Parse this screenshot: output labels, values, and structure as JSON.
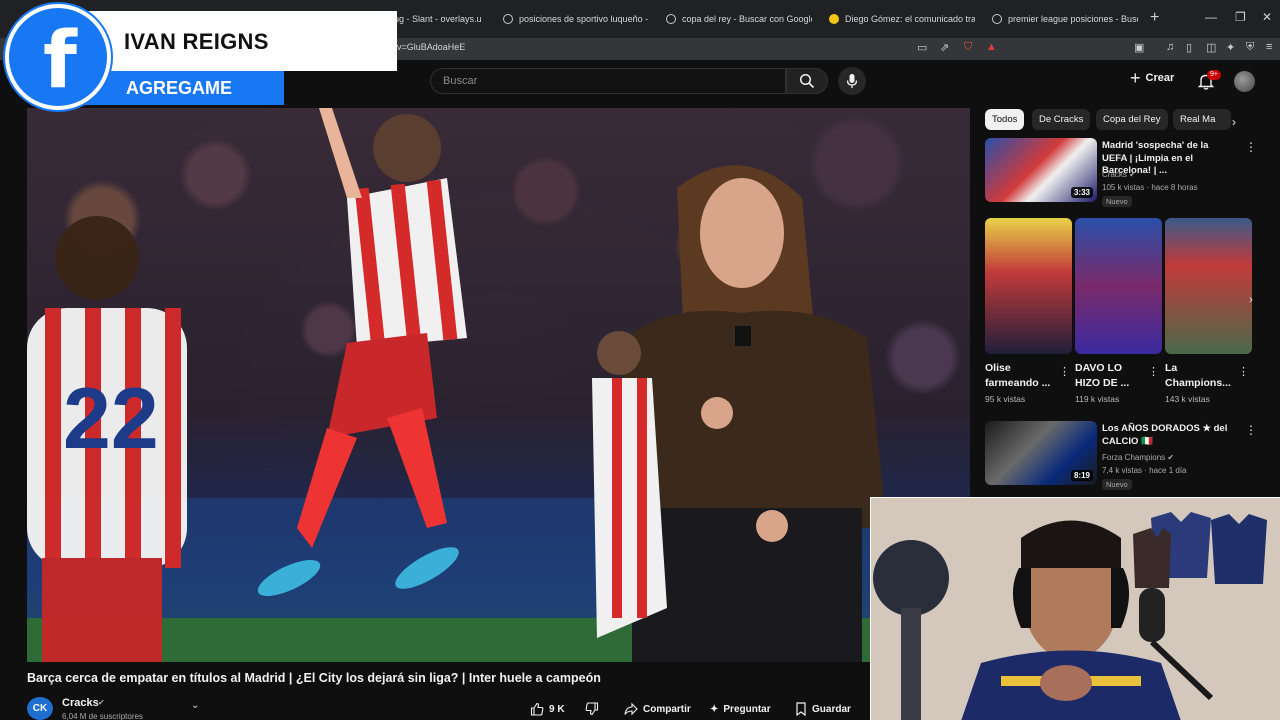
{
  "browser": {
    "tabs": [
      {
        "title": "ebug - Slant - overlays.u",
        "favicon": "debug"
      },
      {
        "title": "posiciones de sportivo luqueño - Bu",
        "favicon": "google"
      },
      {
        "title": "copa del rey - Buscar con Google",
        "favicon": "google"
      },
      {
        "title": "Diego Gómez: el comunicado tras la",
        "favicon": "news"
      },
      {
        "title": "premier league posiciones - Buscar",
        "favicon": "google"
      }
    ],
    "new_tab": "+",
    "url": "v=GluBAdoaHeE"
  },
  "overlay": {
    "name": "IVAN REIGNS",
    "subtitle": "AGREGAME",
    "logo_letter": "f",
    "colors": {
      "facebook_blue": "#1877f2",
      "banner_white": "#ffffff"
    }
  },
  "header": {
    "search_placeholder": "Buscar",
    "create_label": "Crear",
    "notification_count": "9+"
  },
  "video": {
    "title": "Barça cerca de empatar en títulos al Madrid | ¿El City los dejará sin liga? | Inter huele a campeón",
    "channel": "Cracks",
    "channel_initials": "CK",
    "subscribers": "6,04 M de suscriptores",
    "likes": "9 K",
    "share_label": "Compartir",
    "ask_label": "Preguntar",
    "save_label": "Guardar"
  },
  "chips": [
    "Todos",
    "De Cracks",
    "Copa del Rey",
    "Real Ma"
  ],
  "recommendations": [
    {
      "title": "Madrid 'sospecha' de la UEFA | ¡Limpia en el Barcelona! | ...",
      "channel": "Cracks",
      "meta": "105 k vistas · hace 8 horas",
      "badge": "Nuevo",
      "duration": "3:33"
    },
    {
      "title": "Los AÑOS DORADOS ★ del CALCIO 🇮🇹",
      "channel": "Forza Champions",
      "meta": "7,4 k vistas · hace 1 día",
      "badge": "Nuevo",
      "duration": "8:19"
    }
  ],
  "shorts": [
    {
      "title": "Olise farmeando ...",
      "views": "95 k vistas"
    },
    {
      "title": "DAVO LO HIZO DE ...",
      "views": "119 k vistas"
    },
    {
      "title": "La Champions...",
      "views": "143 k vistas"
    }
  ]
}
